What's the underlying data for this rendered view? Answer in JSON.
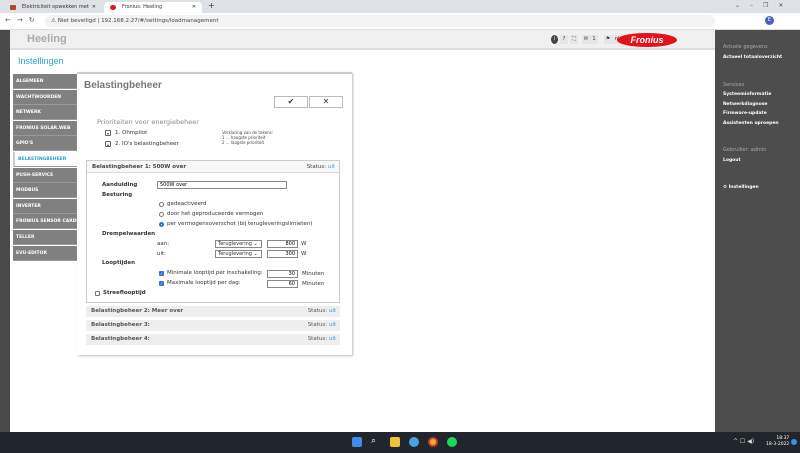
{
  "browser": {
    "tabs": [
      {
        "title": "Elektriciteit opwekken met zonn..."
      },
      {
        "title": "Fronius: Heeling"
      }
    ],
    "new_tab": "+",
    "security": "Niet beveiligd",
    "url": "192.168.2.27/#/settings/loadmanagement",
    "profile": "E"
  },
  "header": {
    "title": "Heeling",
    "icons": [
      "i",
      "?",
      "⛶",
      "✉",
      "1",
      "⚑",
      "nl"
    ],
    "logo": "Fronius"
  },
  "section_title": "Instellingen",
  "nav": [
    "ALGEMEEN",
    "WACHTWOORDEN",
    "NETWERK",
    "FRONIUS SOLAR.WEB",
    "GPIO'S",
    "BELASTINGBEHEER",
    "PUSH-SERVICE",
    "MODBUS",
    "INVERTER",
    "FRONIUS SENSOR CARDS",
    "TELLER",
    "EVU-EDITOR"
  ],
  "main": {
    "title": "Belastingbeheer",
    "confirm": "✔",
    "cancel": "✕",
    "priorities": {
      "title": "Prioriteiten voor energiebeheer",
      "items": [
        "1. Ohmpilot",
        "2. IO's belastingbeheer"
      ],
      "legend_title": "Verklaring van de tekens:",
      "legend": [
        "1 ... hoogste prioriteit",
        "2 ... laagste prioriteit"
      ]
    },
    "panel1": {
      "title": "Belastingbeheer 1: 500W over",
      "status_label": "Status:",
      "status": "uit",
      "aanduiding_label": "Aanduiding",
      "aanduiding": "500W over",
      "besturing_label": "Besturing",
      "options": [
        "gedeactiveerd",
        "door het geproduceerde vermogen",
        "per vermogensoverschot (bij terugleveringslimieten)"
      ],
      "selected_option": 2,
      "drempel_label": "Drempelwaarden",
      "aan_label": "aan:",
      "uit_label": "uit:",
      "aan_select": "Teruglevering",
      "uit_select": "Teruglevering",
      "aan_value": "800",
      "uit_value": "300",
      "unit_w": "W",
      "looptijden_label": "Looptijden",
      "min_label": "Minimale looptijd per inschakeling:",
      "min_value": "30",
      "max_label": "Maximale looptijd per dag:",
      "max_value": "60",
      "unit_min": "Minuten",
      "min_checked": true,
      "max_checked": true,
      "streef_label": "Streeflooptijd",
      "streef_checked": false
    },
    "collapsed": [
      {
        "title": "Belastingbeheer 2: Meer over",
        "status_label": "Status:",
        "status": "uit"
      },
      {
        "title": "Belastingbeheer 3:",
        "status_label": "Status:",
        "status": "uit"
      },
      {
        "title": "Belastingbeheer 4:",
        "status_label": "Status:",
        "status": "uit"
      }
    ]
  },
  "right_panel": {
    "actuele_heading": "Actuele gegevens",
    "actuele_items": [
      "Actueel totaaloverzicht"
    ],
    "services_heading": "Services",
    "services_items": [
      "Systeeminformatie",
      "Netwerkdiagnose",
      "Firmware-update",
      "Assistenten oproepen"
    ],
    "user_heading": "Gebruiker: admin",
    "logout": "Logout",
    "settings": "Instellingen"
  },
  "taskbar": {
    "time": "18:37",
    "date": "18-3-2022"
  },
  "colors": {
    "accent": "#2aa1d1",
    "brand": "#e3131b"
  }
}
